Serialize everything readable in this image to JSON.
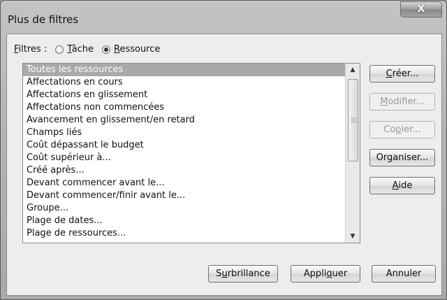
{
  "window": {
    "title": "Plus de filtres",
    "close_glyph": "X"
  },
  "filter_type": {
    "label_prefix": "F",
    "label_rest": "iltres :",
    "options": [
      {
        "pre": "",
        "u": "T",
        "post": "âche",
        "selected": false
      },
      {
        "pre": "",
        "u": "R",
        "post": "essource",
        "selected": true
      }
    ]
  },
  "filters_list": {
    "items": [
      "Toutes les ressources",
      "Affectations en cours",
      "Affectations en glissement",
      "Affectations non commencées",
      "Avancement en glissement/en retard",
      "Champs liés",
      "Coût dépassant le budget",
      "Coût supérieur à...",
      "Créé après...",
      "Devant commencer avant le...",
      "Devant commencer/finir avant le...",
      "Groupe...",
      "Plage de dates...",
      "Plage de ressources..."
    ],
    "selected_index": 0
  },
  "side_buttons": [
    {
      "pre": "",
      "u": "C",
      "post": "réer...",
      "enabled": true
    },
    {
      "pre": "",
      "u": "M",
      "post": "odifier...",
      "enabled": false
    },
    {
      "pre": "Co",
      "u": "p",
      "post": "ier...",
      "enabled": false
    },
    {
      "pre": "Or",
      "u": "g",
      "post": "aniser...",
      "enabled": true
    },
    {
      "pre": "",
      "u": "A",
      "post": "ide",
      "enabled": true
    }
  ],
  "bottom_buttons": [
    {
      "pre": "S",
      "u": "u",
      "post": "rbrillance"
    },
    {
      "pre": "Appli",
      "u": "q",
      "post": "uer"
    },
    {
      "pre": "Annuler",
      "u": "",
      "post": ""
    }
  ]
}
